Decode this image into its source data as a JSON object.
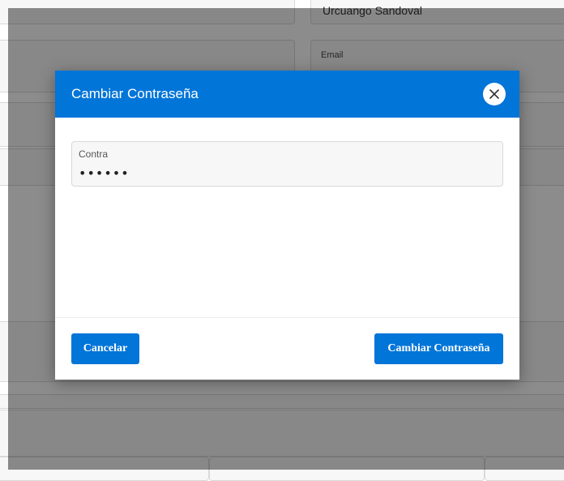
{
  "background": {
    "name_value": "Urcuango Sandoval",
    "email_label": "Email"
  },
  "dialog": {
    "title": "Cambiar Contraseña",
    "close_icon": "close-icon",
    "password_field": {
      "label": "Contra",
      "value": "••••••"
    },
    "cancel_label": "Cancelar",
    "submit_label": "Cambiar Contraseña"
  },
  "colors": {
    "accent": "#0275d8",
    "overlay": "rgba(0,0,0,0.45)"
  }
}
